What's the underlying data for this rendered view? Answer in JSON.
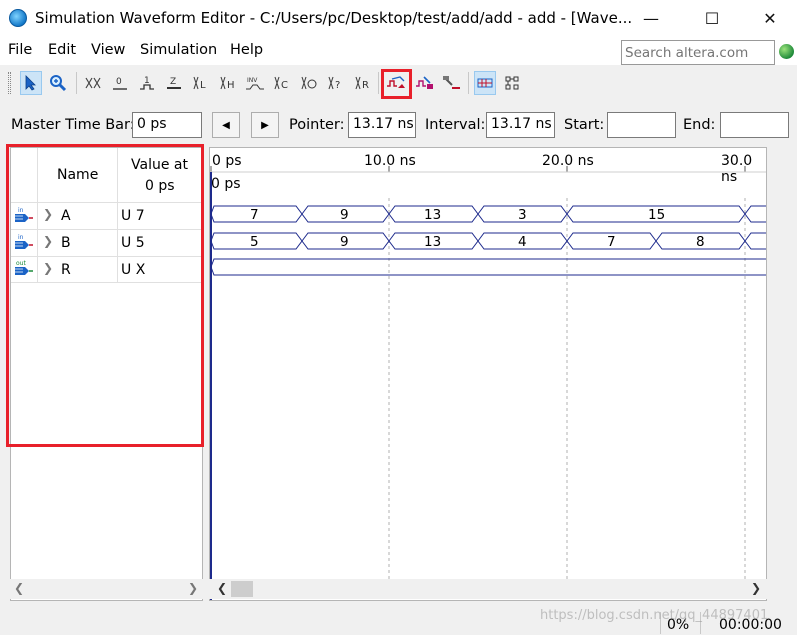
{
  "window": {
    "title": "Simulation Waveform Editor - C:/Users/pc/Desktop/test/add/add - add - [Wave...",
    "minimize_glyph": "—",
    "maximize_glyph": "☐",
    "close_glyph": "✕"
  },
  "menu": {
    "items": [
      "File",
      "Edit",
      "View",
      "Simulation",
      "Help"
    ],
    "search_placeholder": "Search altera.com"
  },
  "toolbar": {
    "icons": [
      "selection-tool-icon",
      "zoom-tool-icon",
      "forcing-unknown-icon",
      "forcing-low-icon",
      "forcing-high-icon",
      "high-impedance-icon",
      "weak-low-icon",
      "weak-high-icon",
      "invert-icon",
      "count-value-icon",
      "clock-icon",
      "random-value-icon",
      "arbitrary-value-icon",
      "run-functional-simulation-icon",
      "run-timing-simulation-icon",
      "generate-netlist-icon",
      "snap-to-grid-icon",
      "sort-icon"
    ]
  },
  "timebar": {
    "master_label": "Master Time Bar:",
    "master_value": "0 ps",
    "prev_glyph": "◀",
    "next_glyph": "▶",
    "pointer_label": "Pointer:",
    "pointer_value": "13.17 ns",
    "interval_label": "Interval:",
    "interval_value": "13.17 ns",
    "start_label": "Start:",
    "start_value": "",
    "end_label": "End:",
    "end_value": ""
  },
  "signals": {
    "header_name": "Name",
    "header_value_line1": "Value at",
    "header_value_line2": "0 ps",
    "rows": [
      {
        "dir": "in",
        "name": "A",
        "value": "U 7"
      },
      {
        "dir": "in",
        "name": "B",
        "value": "U 5"
      },
      {
        "dir": "out",
        "name": "R",
        "value": "U X"
      }
    ]
  },
  "timeline": {
    "ticks": [
      "0 ps",
      "10.0 ns",
      "20.0 ns",
      "30.0 ns"
    ],
    "cursor_label": "0 ps"
  },
  "waves": {
    "A": [
      "7",
      "9",
      "13",
      "3",
      "15"
    ],
    "B": [
      "5",
      "9",
      "13",
      "4",
      "7",
      "8"
    ]
  },
  "status": {
    "progress": "0%",
    "time": "00:00:00"
  },
  "watermark": "https://blog.csdn.net/qq_44897401",
  "colors": {
    "accent_red": "#e8202a",
    "wave_blue": "#1d2a8c"
  }
}
